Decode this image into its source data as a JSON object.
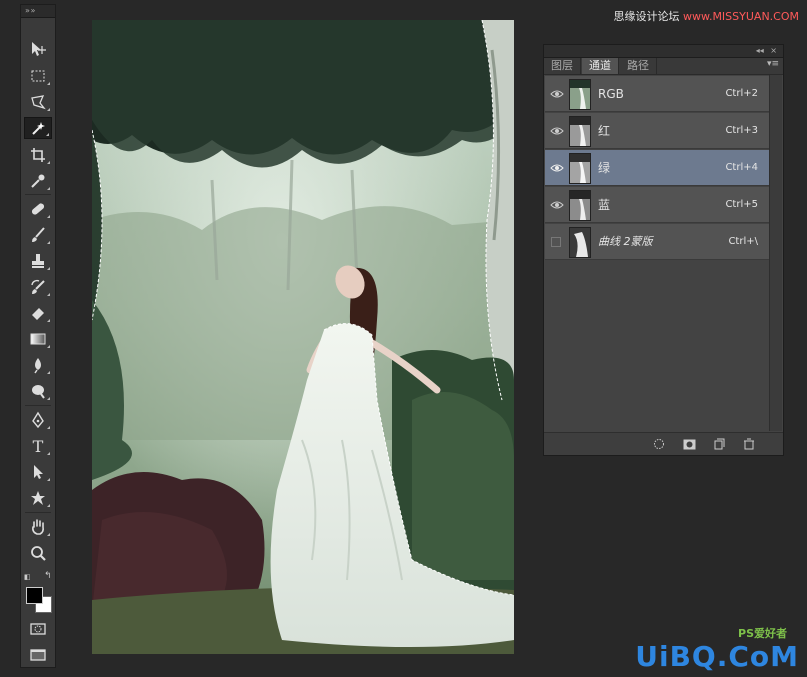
{
  "watermark_top": {
    "text": "思缘设计论坛",
    "url": "www.MISSYUAN.COM"
  },
  "watermark_bottom": {
    "logo": "UiBQ.CoM",
    "sub": "PS爱好者"
  },
  "toolbar": {
    "collapse_glyph": "» »",
    "tools": [
      {
        "name": "move-tool",
        "icon": "move-icon"
      },
      {
        "name": "marquee-tool",
        "icon": "rect-marquee-icon"
      },
      {
        "name": "lasso-tool",
        "icon": "polygonal-lasso-icon"
      },
      {
        "name": "magic-wand-tool",
        "icon": "magic-wand-icon",
        "active": true
      },
      {
        "name": "crop-tool",
        "icon": "crop-icon"
      },
      {
        "name": "eyedropper-tool",
        "icon": "eyedropper-icon"
      },
      {
        "name": "healing-brush-tool",
        "icon": "bandage-icon"
      },
      {
        "name": "brush-tool",
        "icon": "brush-icon"
      },
      {
        "name": "clone-stamp-tool",
        "icon": "stamp-icon"
      },
      {
        "name": "history-brush-tool",
        "icon": "history-brush-icon"
      },
      {
        "name": "eraser-tool",
        "icon": "eraser-icon"
      },
      {
        "name": "gradient-tool",
        "icon": "gradient-icon"
      },
      {
        "name": "blur-tool",
        "icon": "blur-icon"
      },
      {
        "name": "dodge-tool",
        "icon": "dodge-icon"
      },
      {
        "name": "pen-tool",
        "icon": "pen-icon"
      },
      {
        "name": "type-tool",
        "icon": "type-icon"
      },
      {
        "name": "path-selection-tool",
        "icon": "arrow-icon"
      },
      {
        "name": "custom-shape-tool",
        "icon": "shape-icon"
      },
      {
        "name": "hand-tool",
        "icon": "hand-icon"
      },
      {
        "name": "zoom-tool",
        "icon": "zoom-icon"
      }
    ],
    "type_glyph": "T",
    "colors": {
      "foreground": "#000000",
      "background": "#ffffff"
    }
  },
  "panel": {
    "collapse_glyph": "◂◂",
    "close_glyph": "×",
    "menu_glyph": "▾≡",
    "tabs": [
      {
        "label": "图层",
        "active": false
      },
      {
        "label": "通道",
        "active": true
      },
      {
        "label": "路径",
        "active": false
      }
    ],
    "channels": [
      {
        "name": "RGB",
        "shortcut": "Ctrl+2",
        "visible": true,
        "selected": false,
        "thumb": "rgb"
      },
      {
        "name": "红",
        "shortcut": "Ctrl+3",
        "visible": true,
        "selected": false,
        "thumb": "gray"
      },
      {
        "name": "绿",
        "shortcut": "Ctrl+4",
        "visible": true,
        "selected": true,
        "thumb": "gray"
      },
      {
        "name": "蓝",
        "shortcut": "Ctrl+5",
        "visible": true,
        "selected": false,
        "thumb": "gray"
      },
      {
        "name": "曲线 2蒙版",
        "shortcut": "Ctrl+\\",
        "visible": false,
        "selected": false,
        "thumb": "mask"
      }
    ],
    "bottom_buttons": [
      "load-selection-button",
      "save-selection-button",
      "new-channel-button",
      "delete-channel-button"
    ]
  },
  "colors": {
    "app_bg": "#282828",
    "panel_bg": "#535353",
    "selected_row": "#6d7a8f",
    "watermark_blue": "#2e86e0"
  }
}
